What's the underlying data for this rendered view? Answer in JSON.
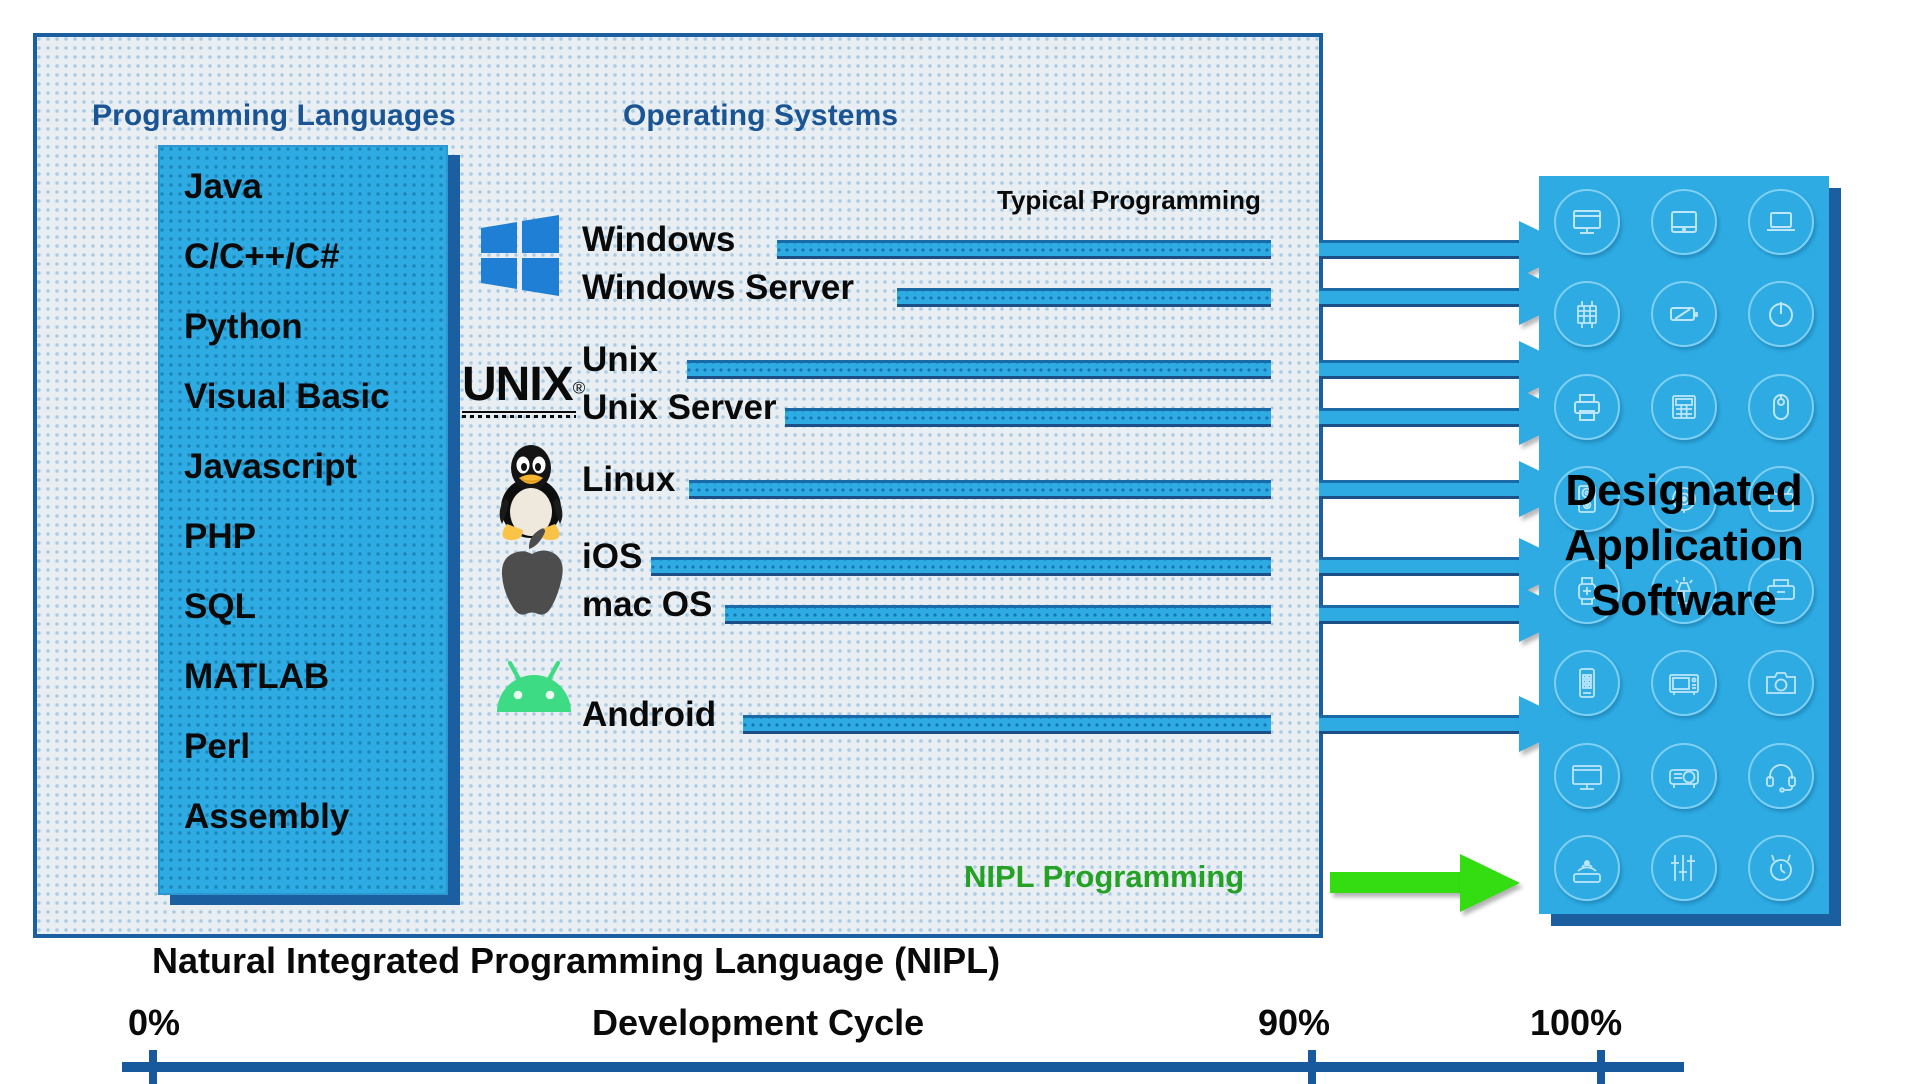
{
  "headers": {
    "languages": "Programming Languages",
    "operating_systems": "Operating Systems"
  },
  "colors": {
    "panel_border": "#1b5fa0",
    "header_text": "#1a5493",
    "bright_blue": "#2dabe2",
    "green_accent": "#25a125",
    "green_arrow": "#33dd11",
    "android_green": "#3ddc84",
    "apple_gray": "#4d4d4d",
    "windows_blue": "#1f7fd4",
    "axis_blue": "#17599c",
    "panel_bg": "#e8eef2"
  },
  "languages": [
    "Java",
    "C/C++/C#",
    "Python",
    "Visual Basic",
    "Javascript",
    "PHP",
    "SQL",
    "MATLAB",
    "Perl",
    "Assembly"
  ],
  "typical_programming_label": "Typical Programming",
  "operating_systems": [
    {
      "name": "Windows",
      "icon": "windows-logo-icon"
    },
    {
      "name": "Windows Server",
      "icon": "windows-logo-icon"
    },
    {
      "name": "Unix",
      "icon": "unix-logo-icon"
    },
    {
      "name": "Unix Server",
      "icon": "unix-logo-icon"
    },
    {
      "name": "Linux",
      "icon": "linux-penguin-icon"
    },
    {
      "name": "iOS",
      "icon": "apple-logo-icon"
    },
    {
      "name": "mac OS",
      "icon": "apple-logo-icon"
    },
    {
      "name": "Android",
      "icon": "android-robot-icon"
    }
  ],
  "unix_wordmark": "UNIX",
  "nipl_programming_label": "NIPL Programming",
  "app_panel": {
    "title_line1": "Designated",
    "title_line2": "Application",
    "title_line3": "Software",
    "icons": [
      "desktop-monitor-icon",
      "tablet-icon",
      "laptop-icon",
      "circuit-board-icon",
      "battery-icon",
      "power-button-icon",
      "printer-icon",
      "calculator-icon",
      "computer-mouse-icon",
      "speaker-icon",
      "webcam-icon",
      "television-icon",
      "smartwatch-icon",
      "desk-lamp-icon",
      "scanner-icon",
      "smartphone-icon",
      "microwave-icon",
      "camera-icon",
      "widescreen-monitor-icon",
      "projector-icon",
      "headset-icon",
      "wifi-router-icon",
      "equalizer-icon",
      "wall-clock-icon"
    ]
  },
  "caption": "Natural Integrated Programming Language (NIPL)",
  "chart_data": {
    "type": "bar",
    "title": "Development Cycle",
    "xlabel": "Development Cycle",
    "categories": [
      "Typical Programming",
      "NIPL Programming"
    ],
    "values": [
      90,
      100
    ],
    "axis_ticks": [
      {
        "label": "0%",
        "value": 0
      },
      {
        "label": "90%",
        "value": 90
      },
      {
        "label": "100%",
        "value": 100
      }
    ],
    "xlim": [
      0,
      108
    ],
    "grid": false,
    "annotation": "Natural Integrated Programming Language (NIPL)"
  }
}
